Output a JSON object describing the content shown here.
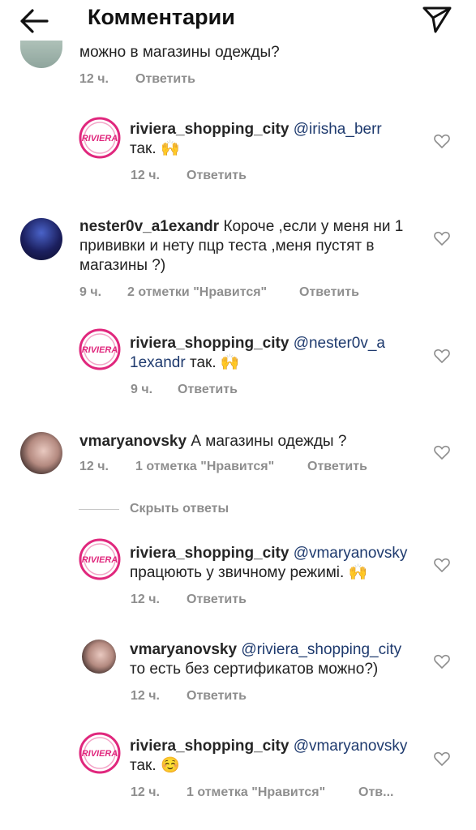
{
  "header": {
    "title": "Комментарии"
  },
  "comments": [
    {
      "text": "можно в магазины одежды?",
      "time": "12 ч.",
      "reply": "Ответить"
    },
    {
      "username": "riviera_shopping_city",
      "mention": "@irisha_berr",
      "text": "так.",
      "emoji": "🙌",
      "time": "12 ч.",
      "reply": "Ответить"
    },
    {
      "username": "nester0v_a1exandr",
      "text": "Короче ,если у меня ни 1 прививки и нету пцр теста ,меня пустят в магазины ?)",
      "time": "9 ч.",
      "likes": "2 отметки \"Нравится\"",
      "reply": "Ответить"
    },
    {
      "username": "riviera_shopping_city",
      "mention": "@nester0v_a1exandr",
      "text": "так.",
      "emoji": "🙌",
      "time": "9 ч.",
      "reply": "Ответить"
    },
    {
      "username": "vmaryanovsky",
      "text": "А магазины одежды ?",
      "time": "12 ч.",
      "likes": "1 отметка \"Нравится\"",
      "reply": "Ответить"
    },
    {
      "username": "riviera_shopping_city",
      "mention": "@vmaryanovsky",
      "text": "працюють у звичному режимі.",
      "emoji": "🙌",
      "time": "12 ч.",
      "reply": "Ответить"
    },
    {
      "username": "vmaryanovsky",
      "mention": "@riviera_shopping_city",
      "text": "то есть без сертификатов можно?)",
      "time": "12 ч.",
      "reply": "Ответить"
    },
    {
      "username": "riviera_shopping_city",
      "mention": "@vmaryanovsky",
      "text": "так.",
      "emoji": "☺️",
      "time": "12 ч.",
      "likes": "1 отметка \"Нравится\"",
      "reply": "Отв..."
    }
  ],
  "hide_replies": "Скрыть ответы",
  "logo_text": "RIVIERA",
  "colors": {
    "brand_pink": "#e0277d",
    "muted": "#8e8e8e",
    "mention": "#1e3a6e"
  },
  "icons": {
    "back": "arrow-left-icon",
    "send": "paper-plane-icon",
    "like": "heart-outline-icon"
  }
}
